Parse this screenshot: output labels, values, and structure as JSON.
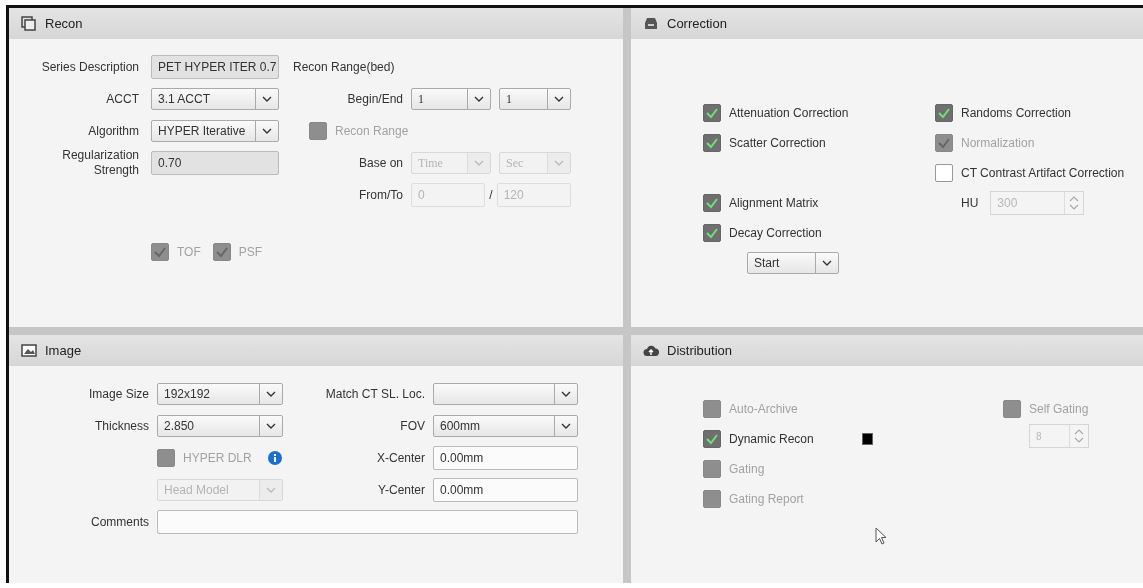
{
  "recon": {
    "title": "Recon",
    "series_description": {
      "label": "Series Description",
      "value": "PET HYPER ITER 0.7",
      "readonly": true,
      "disabled": false
    },
    "acct": {
      "label": "ACCT",
      "value": "3.1 ACCT",
      "disabled": false
    },
    "algorithm": {
      "label": "Algorithm",
      "value": "HYPER Iterative",
      "disabled": false
    },
    "regularization_strength": {
      "label": "Regularization Strength",
      "value": "0.70",
      "readonly": true,
      "disabled": false
    },
    "options": [
      {
        "label": "TOF",
        "checked": true,
        "disabled": true
      },
      {
        "label": "PSF",
        "checked": true,
        "disabled": true
      }
    ],
    "recon_range_heading": "Recon Range(bed)",
    "begin_end": {
      "label": "Begin/End",
      "begin": "1",
      "end": "1",
      "disabled": false
    },
    "recon_range": {
      "label": "Recon Range",
      "checked": false,
      "disabled": true
    },
    "base_on": {
      "label": "Base on",
      "mode": "Time",
      "unit": "Sec",
      "disabled": true
    },
    "from_to": {
      "label": "From/To",
      "from": "0",
      "separator": "/",
      "to": "120",
      "disabled": true
    }
  },
  "correction": {
    "title": "Correction",
    "left": [
      {
        "label": "Attenuation Correction",
        "checked": true,
        "disabled": false
      },
      {
        "label": "Scatter Correction",
        "checked": true,
        "disabled": false
      },
      {
        "label": "Alignment Matrix",
        "checked": true,
        "disabled": false
      },
      {
        "label": "Decay Correction",
        "checked": true,
        "disabled": false
      }
    ],
    "decay_start": {
      "value": "Start",
      "disabled": false
    },
    "right": [
      {
        "label": "Randoms Correction",
        "checked": true,
        "disabled": false
      },
      {
        "label": "Normalization",
        "checked": true,
        "disabled": true
      },
      {
        "label": "CT Contrast Artifact Correction",
        "checked": false,
        "disabled": false
      }
    ],
    "hu": {
      "label": "HU",
      "value": "300",
      "disabled": true
    }
  },
  "image": {
    "title": "Image",
    "image_size": {
      "label": "Image Size",
      "value": "192x192",
      "disabled": false
    },
    "thickness": {
      "label": "Thickness",
      "value": "2.850",
      "disabled": false
    },
    "hyper_dlr": {
      "label": "HYPER DLR",
      "checked": false,
      "disabled": true
    },
    "head_model": {
      "value": "Head Model",
      "disabled": true
    },
    "comments": {
      "label": "Comments",
      "disabled": false
    },
    "match_ct": {
      "label": "Match CT SL. Loc.",
      "disabled": false
    },
    "fov": {
      "label": "FOV",
      "value": "600mm",
      "disabled": false
    },
    "x_center": {
      "label": "X-Center",
      "value": "0.00mm",
      "disabled": false
    },
    "y_center": {
      "label": "Y-Center",
      "value": "0.00mm",
      "disabled": false
    }
  },
  "distribution": {
    "title": "Distribution",
    "left": [
      {
        "label": "Auto-Archive",
        "checked": false,
        "disabled": true
      },
      {
        "label": "Dynamic Recon",
        "checked": true,
        "disabled": false,
        "indicator": true
      },
      {
        "label": "Gating",
        "checked": false,
        "disabled": true
      },
      {
        "label": "Gating Report",
        "checked": false,
        "disabled": true
      }
    ],
    "right": [
      {
        "label": "Self Gating",
        "checked": false,
        "disabled": true
      }
    ],
    "gating_count": {
      "value": "8",
      "disabled": true
    }
  }
}
